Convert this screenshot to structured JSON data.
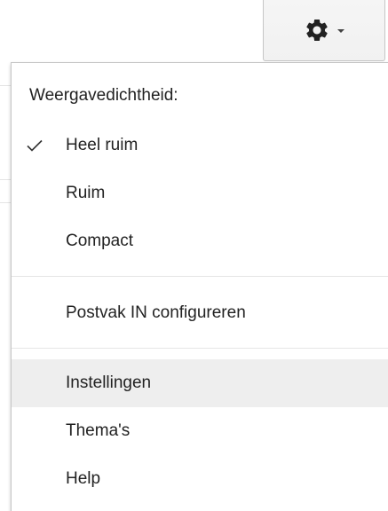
{
  "settings_button": {
    "icon": "gear-icon",
    "dropdown_icon": "caret-down-icon"
  },
  "menu": {
    "density_header": "Weergavedichtheid:",
    "density_options": [
      {
        "label": "Heel ruim",
        "checked": true
      },
      {
        "label": "Ruim",
        "checked": false
      },
      {
        "label": "Compact",
        "checked": false
      }
    ],
    "configure_inbox": "Postvak IN configureren",
    "settings": "Instellingen",
    "themes": "Thema's",
    "help": "Help",
    "hovered_item": "Instellingen"
  },
  "colors": {
    "text": "#222222",
    "hover_background": "#eeeeee",
    "border": "#c6c6c6",
    "separator": "#e5e5e5"
  }
}
